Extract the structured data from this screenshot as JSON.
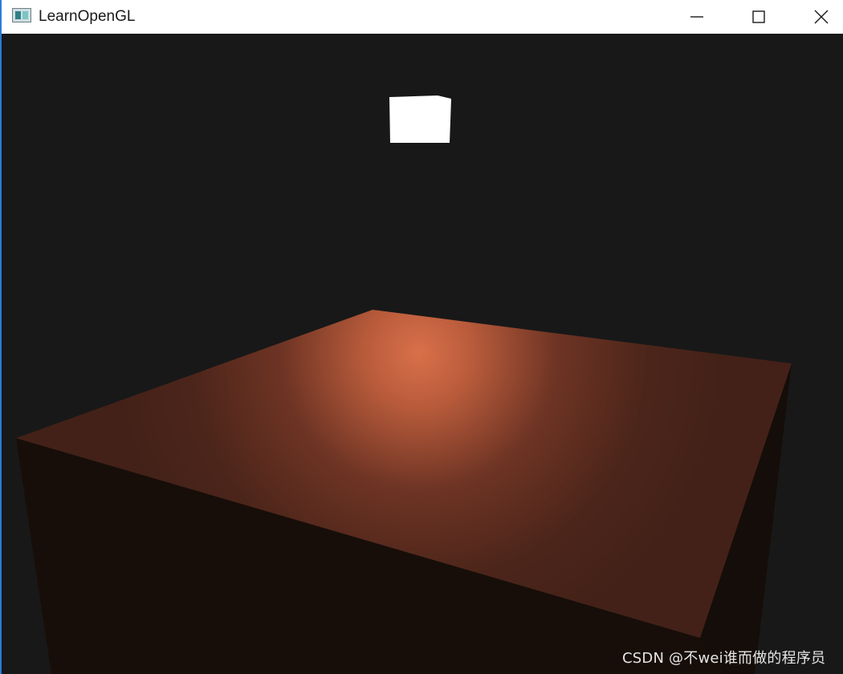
{
  "window": {
    "title": "LearnOpenGL",
    "icon": "app-window-icon",
    "controls": {
      "minimize_icon": "minimize-icon",
      "maximize_icon": "maximize-icon",
      "close_icon": "close-icon"
    }
  },
  "scene": {
    "background_color": "#181818",
    "light_color": "#ffffff",
    "surface_highlight_color": "#d9704a",
    "surface_base_color": "#4a2419",
    "side_face_color": "#170e09"
  },
  "watermark": {
    "text": "CSDN @不wei谁而做的程序员"
  }
}
